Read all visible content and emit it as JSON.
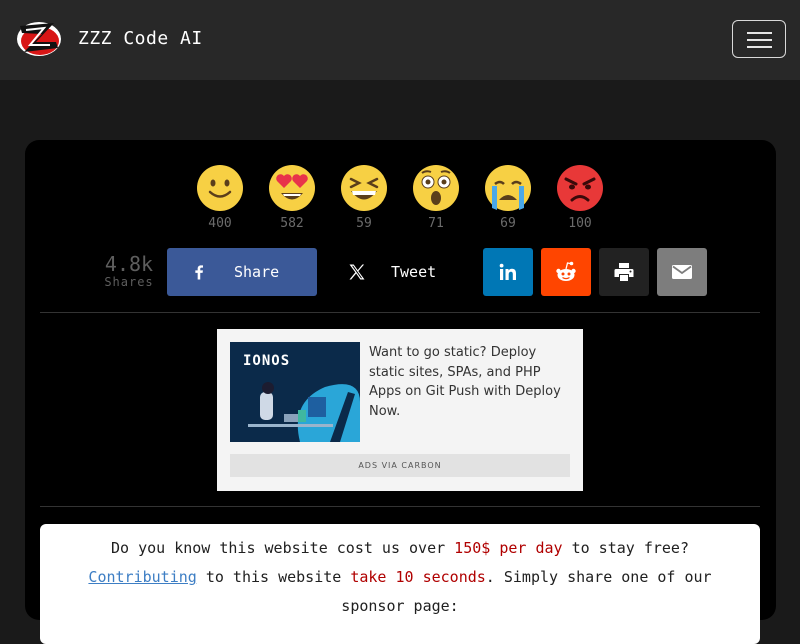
{
  "navbar": {
    "brand_name": "ZZZ Code AI",
    "logo_icon": "zzz-logo-icon",
    "menu_icon": "hamburger-menu-icon"
  },
  "reactions": [
    {
      "icon": "smile-emoji-icon",
      "count": "400"
    },
    {
      "icon": "heart-eyes-emoji-icon",
      "count": "582"
    },
    {
      "icon": "laughing-emoji-icon",
      "count": "59"
    },
    {
      "icon": "astonished-emoji-icon",
      "count": "71"
    },
    {
      "icon": "crying-emoji-icon",
      "count": "69"
    },
    {
      "icon": "angry-emoji-icon",
      "count": "100"
    }
  ],
  "share": {
    "total": "4.8k",
    "total_label": "Shares",
    "facebook_label": "Share",
    "twitter_label": "Tweet",
    "icons": [
      "facebook-icon",
      "x-icon",
      "linkedin-icon",
      "reddit-icon",
      "print-icon",
      "email-icon"
    ],
    "colors": {
      "facebook": "#3b5998",
      "linkedin": "#0077b5",
      "reddit": "#ff4500",
      "print": "#222222",
      "email": "#7d7d7d"
    }
  },
  "ad": {
    "brand": "IONOS",
    "text": "Want to go static? Deploy static sites, SPAs, and PHP Apps on Git Push with Deploy Now.",
    "via": "ADS VIA CARBON"
  },
  "notice": {
    "line1_a": "Do you know this website cost us over ",
    "line1_hl": "150$ per day",
    "line1_b": " to stay free?",
    "link": "Contributing",
    "line2_a": " to this website ",
    "line2_hl": "take 10 seconds",
    "line2_b": ". Simply share one of our sponsor page:"
  }
}
